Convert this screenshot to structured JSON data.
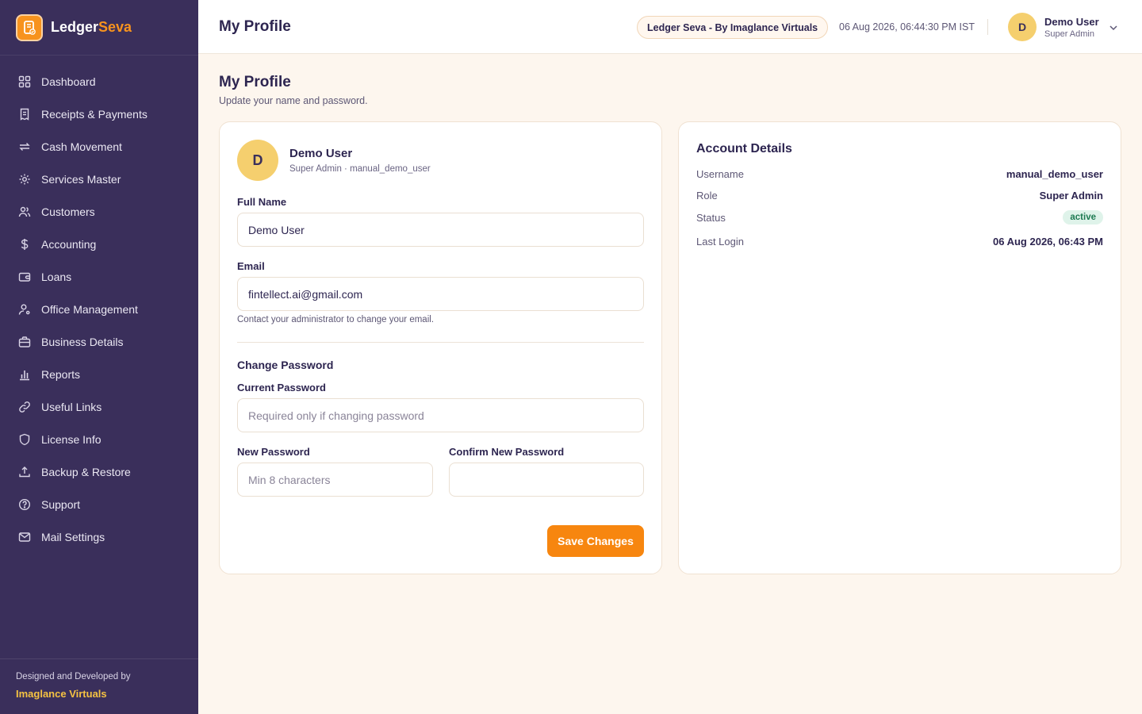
{
  "app": {
    "name_part1": "Ledger",
    "name_part2": "Seva"
  },
  "sidebar": {
    "items": [
      {
        "label": "Dashboard",
        "icon": "grid-icon"
      },
      {
        "label": "Receipts & Payments",
        "icon": "receipt-icon"
      },
      {
        "label": "Cash Movement",
        "icon": "transfer-icon"
      },
      {
        "label": "Services Master",
        "icon": "gear-icon"
      },
      {
        "label": "Customers",
        "icon": "users-icon"
      },
      {
        "label": "Accounting",
        "icon": "dollar-icon"
      },
      {
        "label": "Loans",
        "icon": "wallet-icon"
      },
      {
        "label": "Office Management",
        "icon": "user-cog-icon"
      },
      {
        "label": "Business Details",
        "icon": "briefcase-icon"
      },
      {
        "label": "Reports",
        "icon": "bar-chart-icon"
      },
      {
        "label": "Useful Links",
        "icon": "link-icon"
      },
      {
        "label": "License Info",
        "icon": "shield-icon"
      },
      {
        "label": "Backup & Restore",
        "icon": "upload-icon"
      },
      {
        "label": "Support",
        "icon": "support-icon"
      },
      {
        "label": "Mail Settings",
        "icon": "mail-icon"
      }
    ],
    "footer": {
      "line1": "Designed and Developed by",
      "line2": "Imaglance Virtuals"
    }
  },
  "topbar": {
    "title": "My Profile",
    "brand_pill": "Ledger Seva - By Imaglance Virtuals",
    "datetime": "06 Aug 2026, 06:44:30 PM IST",
    "user": {
      "initial": "D",
      "name": "Demo User",
      "role": "Super Admin"
    }
  },
  "page": {
    "title": "My Profile",
    "subtitle": "Update your name and password."
  },
  "profile": {
    "initial": "D",
    "name": "Demo User",
    "meta": "Super Admin · manual_demo_user",
    "full_name_label": "Full Name",
    "full_name_value": "Demo User",
    "email_label": "Email",
    "email_value": "fintellect.ai@gmail.com",
    "email_hint": "Contact your administrator to change your email.",
    "change_password_title": "Change Password",
    "current_password_label": "Current Password",
    "current_password_placeholder": "Required only if changing password",
    "new_password_label": "New Password",
    "new_password_placeholder": "Min 8 characters",
    "confirm_password_label": "Confirm New Password",
    "confirm_password_placeholder": "",
    "save_label": "Save Changes"
  },
  "account": {
    "title": "Account Details",
    "username_label": "Username",
    "username_value": "manual_demo_user",
    "role_label": "Role",
    "role_value": "Super Admin",
    "status_label": "Status",
    "status_value": "active",
    "last_login_label": "Last Login",
    "last_login_value": "06 Aug 2026, 06:43 PM"
  },
  "colors": {
    "sidebar_bg": "#3a2f5b",
    "accent_orange": "#f7860f",
    "footer_brand": "#f5c242",
    "avatar_bg": "#f5cf6e",
    "page_bg": "#fdf6ee"
  }
}
